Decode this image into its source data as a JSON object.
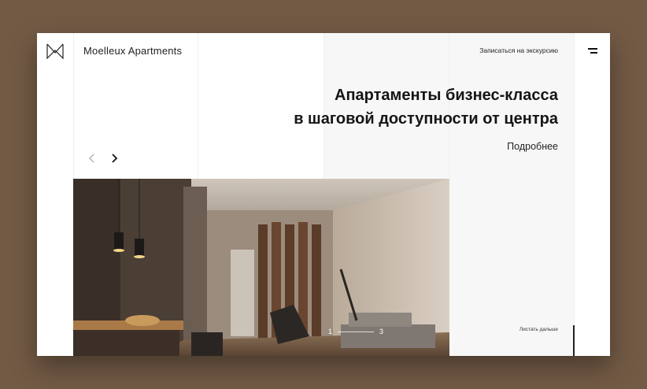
{
  "header": {
    "brand": "Moelleux Apartments",
    "tour_link": "Записаться на экскурсию",
    "logo_icon": "m-monogram-icon",
    "menu_icon": "hamburger-menu-icon"
  },
  "hero": {
    "headline_line1": "Апартаменты бизнес-класса",
    "headline_line2": "в шаговой доступности от центра",
    "more_link": "Подробнее",
    "prev_icon": "chevron-left-icon",
    "next_icon": "chevron-right-icon"
  },
  "slider": {
    "current": "1",
    "total": "3",
    "scroll_hint": "Листать дальше"
  },
  "colors": {
    "page_background": "#725a45",
    "accent": "#151515"
  }
}
